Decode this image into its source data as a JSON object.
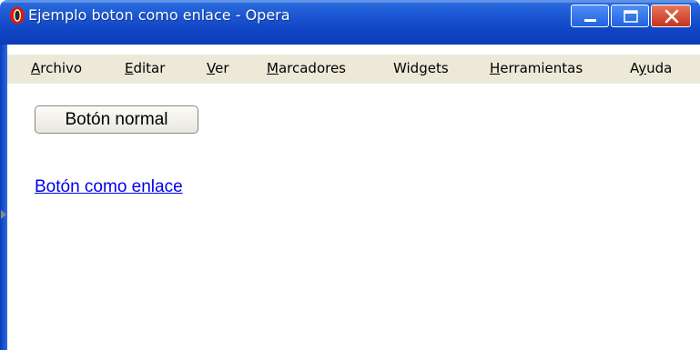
{
  "window": {
    "title": "Ejemplo boton como enlace - Opera",
    "controls": {
      "minimize_icon": "minimize-icon",
      "maximize_icon": "maximize-icon",
      "close_icon": "close-icon"
    }
  },
  "menubar": {
    "items": [
      {
        "pre": "",
        "key": "A",
        "post": "rchivo"
      },
      {
        "pre": "",
        "key": "E",
        "post": "ditar"
      },
      {
        "pre": "",
        "key": "V",
        "post": "er"
      },
      {
        "pre": "",
        "key": "M",
        "post": "arcadores"
      },
      {
        "pre": "Wid",
        "key": "g",
        "post": "ets"
      },
      {
        "pre": "",
        "key": "H",
        "post": "erramientas"
      },
      {
        "pre": "A",
        "key": "y",
        "post": "uda"
      }
    ]
  },
  "content": {
    "normal_button_label": "Botón normal",
    "link_button_label": "Botón como enlace"
  },
  "colors": {
    "titlebar": "#1c56d4",
    "menubar": "#ece9d8",
    "link": "#0000ee",
    "close_button": "#c7321d"
  }
}
